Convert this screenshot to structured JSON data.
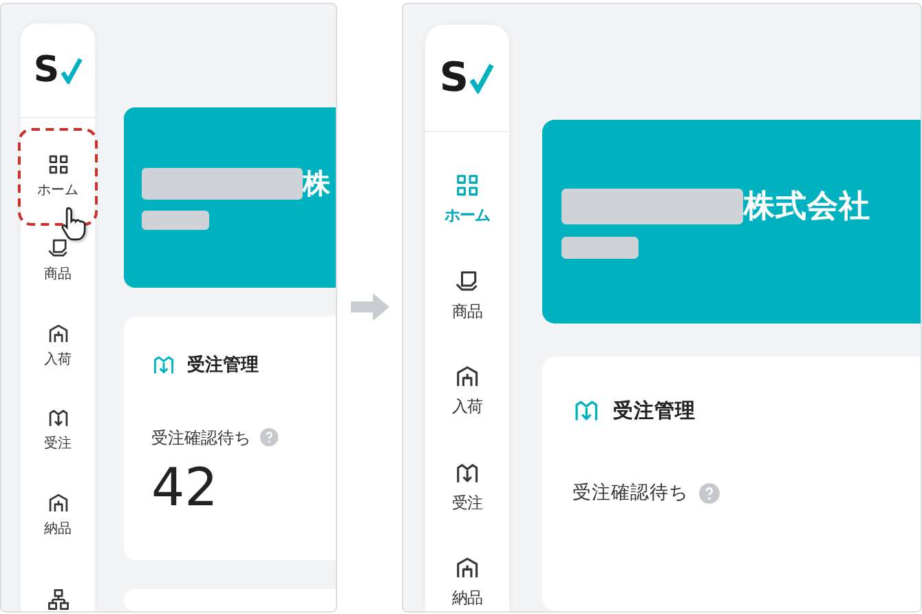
{
  "panels": [
    {
      "kind": "before",
      "logo": "S",
      "nav": [
        {
          "label": "ホーム",
          "selected": false,
          "highlighted": true,
          "pointer": true
        },
        {
          "label": "商品",
          "selected": false,
          "highlighted": false,
          "pointer": false
        },
        {
          "label": "入荷",
          "selected": false,
          "highlighted": false,
          "pointer": false
        },
        {
          "label": "受注",
          "selected": false,
          "highlighted": false,
          "pointer": false
        },
        {
          "label": "納品",
          "selected": false,
          "highlighted": false,
          "pointer": false
        },
        {
          "selected": false,
          "highlighted": false,
          "pointer": false
        }
      ],
      "company": "株",
      "card": {
        "title": "受注管理",
        "metric_label": "受注確認待ち",
        "metric_value": "42"
      }
    },
    {
      "kind": "after",
      "logo": "S",
      "nav": [
        {
          "label": "ホーム",
          "selected": true,
          "highlighted": false,
          "pointer": false
        },
        {
          "label": "商品",
          "selected": false,
          "highlighted": false,
          "pointer": false
        },
        {
          "label": "入荷",
          "selected": false,
          "highlighted": false,
          "pointer": false
        },
        {
          "label": "受注",
          "selected": false,
          "highlighted": false,
          "pointer": false
        },
        {
          "label": "納品",
          "selected": false,
          "highlighted": false,
          "pointer": false
        }
      ],
      "company": "株式会社",
      "card": {
        "title": "受注管理",
        "metric_label": "受注確認待ち"
      }
    }
  ]
}
